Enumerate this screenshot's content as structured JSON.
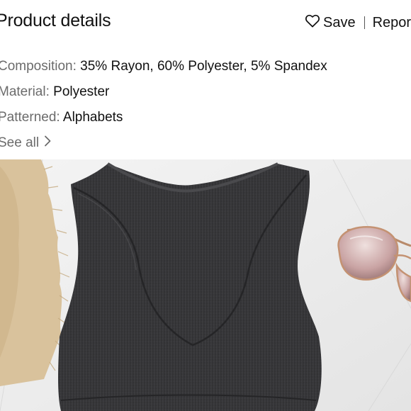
{
  "header": {
    "title": "Product details",
    "save_label": "Save",
    "report_label": "Report"
  },
  "details": {
    "composition": {
      "label": "Composition:",
      "value": "35% Rayon, 60% Polyester, 5% Spandex"
    },
    "material": {
      "label": "Material:",
      "value": "Polyester"
    },
    "patterned": {
      "label": "Patterned:",
      "value": "Alphabets"
    },
    "see_all_label": "See all"
  },
  "photo": {
    "icons": [
      "heart-icon",
      "chevron-right-icon"
    ],
    "colors": {
      "tank": "#3a3a3c",
      "background": "#efefef",
      "straw": "#dcc7a5",
      "lens": "#c9a3a3"
    }
  }
}
